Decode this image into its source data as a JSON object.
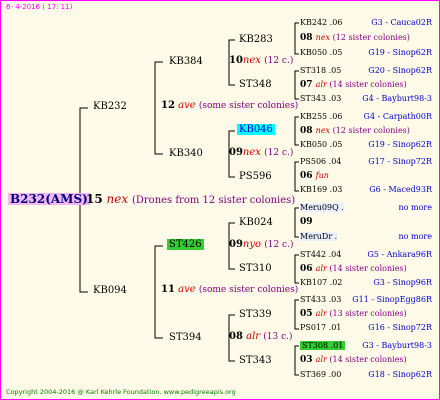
{
  "header": {
    "date": "6- 4-2016 ( 17: 11)"
  },
  "footer": {
    "copyright": "Copyright 2004-2016 @ Karl Kehrle Foundation.   www.pedigreeapis.org"
  },
  "root": {
    "name": "B232(AMS)",
    "year": "15",
    "queen_tag": "nex",
    "note": "(Drones from 12 sister colonies)"
  },
  "gen1": [
    {
      "name": "KB232",
      "year": "12",
      "tag": "ave",
      "note": "(some sister colonies)"
    },
    {
      "name": "KB094",
      "year": "11",
      "tag": "ave",
      "note": "(some sister colonies)"
    }
  ],
  "gen2": [
    {
      "name": "KB384",
      "year": "10",
      "tag": "nex",
      "note": "(12 c.)"
    },
    {
      "name": "KB340",
      "year": "09",
      "tag": "nex",
      "note": "(12 c.)"
    },
    {
      "name": "ST426",
      "year": "09",
      "tag": "nyo",
      "note": "(12 c.)"
    },
    {
      "name": "ST394",
      "year": "08",
      "tag": "alr",
      "note": "(13 c.)"
    }
  ],
  "gen3": [
    {
      "name": "KB283"
    },
    {
      "name": "ST348"
    },
    {
      "name": "KB046"
    },
    {
      "name": "PS596"
    },
    {
      "name": "KB024"
    },
    {
      "name": "ST310"
    },
    {
      "name": "ST339"
    },
    {
      "name": "ST343"
    }
  ],
  "gen4": [
    {
      "a": "KB242 .06",
      "b": "G3 - Cauca02R"
    },
    {
      "a": "08",
      "tag": "nex",
      "note": "(12 sister colonies)"
    },
    {
      "a": "KB050 .05",
      "b": "G19 - Sinop62R"
    },
    {
      "a": "ST318 .05",
      "b": "G20 - Sinop62R"
    },
    {
      "a": "07",
      "tag": "alr",
      "note": "(14 sister colonies)"
    },
    {
      "a": "ST343 .03",
      "b": "G4 - Bayburt98-3"
    },
    {
      "a": "KB255 .06",
      "b": "G4 - Carpath00R"
    },
    {
      "a": "08",
      "tag": "nex",
      "note": "(12 sister colonies)"
    },
    {
      "a": "KB050 .05",
      "b": "G19 - Sinop62R"
    },
    {
      "a": "PS506 .04",
      "b": "G17 - Sinop72R"
    },
    {
      "a": "06",
      "tag": "fun",
      "note": ""
    },
    {
      "a": "KB169 .03",
      "b": "G6 - Maced93R"
    },
    {
      "a": "Meru09Q .",
      "b": "no more"
    },
    {
      "a": "09",
      "tag": "",
      "note": ""
    },
    {
      "a": "MeruDr .",
      "b": "no more"
    },
    {
      "a": "ST442 .04",
      "b": "G5 - Ankara96R"
    },
    {
      "a": "06",
      "tag": "alr",
      "note": "(14 sister colonies)"
    },
    {
      "a": "KB107 .02",
      "b": "G3 - Sinop96R"
    },
    {
      "a": "ST433 .03",
      "b": "G11 - SinopEgg86R"
    },
    {
      "a": "05",
      "tag": "alr",
      "note": "(13 sister colonies)"
    },
    {
      "a": "PS017 .01",
      "b": "G16 - Sinop72R"
    },
    {
      "a": "ST308 .01",
      "b": "G3 - Bayburt98-3"
    },
    {
      "a": "03",
      "tag": "alr",
      "note": "(14 sister colonies)"
    },
    {
      "a": "ST369 .00",
      "b": "G18 - Sinop62R"
    }
  ],
  "colors": {
    "frame": "#ff00ff",
    "background": "#fffbe8",
    "highlight_cyan": "#00ffff",
    "highlight_green": "#33cc33"
  }
}
